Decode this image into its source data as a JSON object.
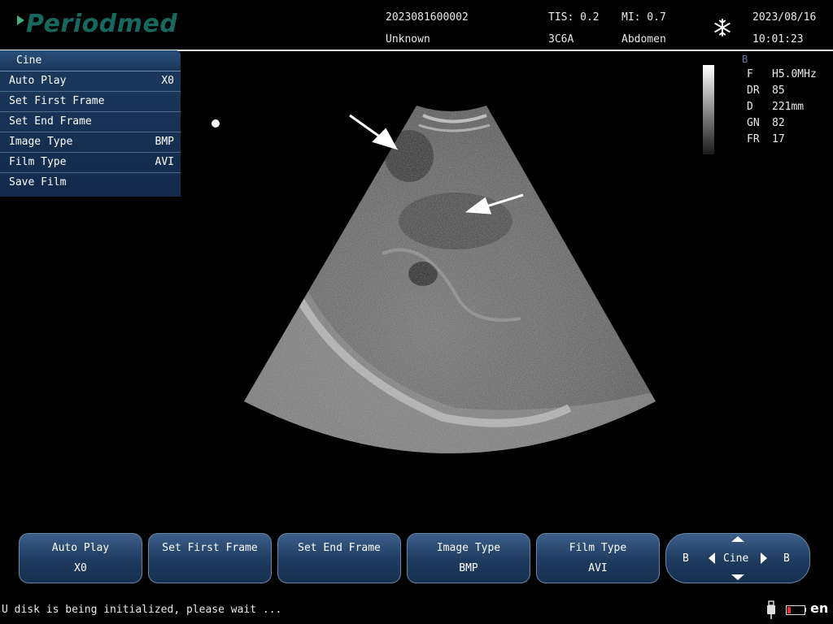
{
  "header": {
    "logo_text": "Periodmed",
    "patient_id": "2023081600002",
    "patient_name": "Unknown",
    "tis": "TIS: 0.2",
    "mi": "MI: 0.7",
    "probe": "3C6A",
    "preset": "Abdomen",
    "date": "2023/08/16",
    "time": "10:01:23"
  },
  "cine_menu": {
    "title": "Cine",
    "items": [
      {
        "label": "Auto Play",
        "value": "X0"
      },
      {
        "label": "Set First Frame",
        "value": ""
      },
      {
        "label": "Set End Frame",
        "value": ""
      },
      {
        "label": "Image Type",
        "value": "BMP"
      },
      {
        "label": "Film Type",
        "value": "AVI"
      },
      {
        "label": "Save Film",
        "value": ""
      }
    ]
  },
  "params": {
    "mode": "B",
    "rows": [
      {
        "key": "F",
        "value": "H5.0MHz"
      },
      {
        "key": "DR",
        "value": "85"
      },
      {
        "key": "D",
        "value": "221mm"
      },
      {
        "key": "GN",
        "value": "82"
      },
      {
        "key": "FR",
        "value": "17"
      }
    ]
  },
  "soft_buttons": [
    {
      "line1": "Auto Play",
      "line2": "X0"
    },
    {
      "line1": "Set First Frame",
      "line2": ""
    },
    {
      "line1": "Set End Frame",
      "line2": ""
    },
    {
      "line1": "Image Type",
      "line2": "BMP"
    },
    {
      "line1": "Film Type",
      "line2": "AVI"
    }
  ],
  "nav_pad": {
    "center": "Cine",
    "left": "B",
    "right": "B"
  },
  "status": {
    "message": "U disk is being initialized, please wait ...",
    "language": "en"
  },
  "colors": {
    "accent": "#1e3a5f",
    "logo": "#17685f",
    "battery_low": "#dd3333"
  },
  "icons": {
    "freeze": "snowflake-icon",
    "usb": "usb-icon",
    "battery": "battery-icon"
  }
}
